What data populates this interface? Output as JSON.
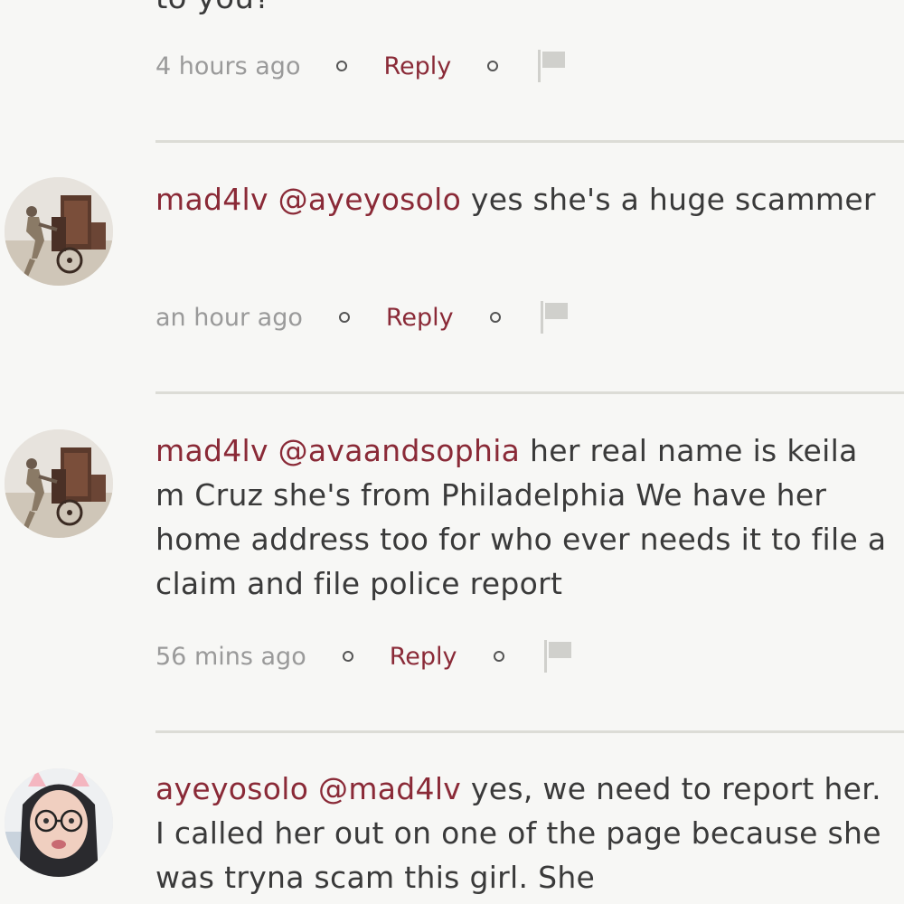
{
  "top_partial": {
    "text_fragment": "to you?",
    "time": "4 hours ago",
    "reply_label": "Reply"
  },
  "comments": [
    {
      "username": "mad4lv",
      "mention": "@ayeyosolo",
      "text": "yes she's a huge scammer",
      "time": "an hour ago",
      "reply_label": "Reply",
      "avatar_icon": "man-pushing-cart-avatar"
    },
    {
      "username": "mad4lv",
      "mention": "@avaandsophia",
      "text": "her real name is keila m Cruz she's from Philadelphia We have her home address too for who ever needs it to file a claim and file police report",
      "time": "56 mins ago",
      "reply_label": "Reply",
      "avatar_icon": "man-pushing-cart-avatar"
    },
    {
      "username": "ayeyosolo",
      "mention": "@mad4lv",
      "text": "yes, we need to report her. I called her out on one of the page because she was tryna scam this girl. She",
      "avatar_icon": "woman-with-glasses-avatar"
    }
  ],
  "colors": {
    "background": "#f7f7f5",
    "username": "#8a2a37",
    "text": "#3a3a3a",
    "timestamp": "#9a9a9a",
    "divider": "#dcdcd6"
  }
}
